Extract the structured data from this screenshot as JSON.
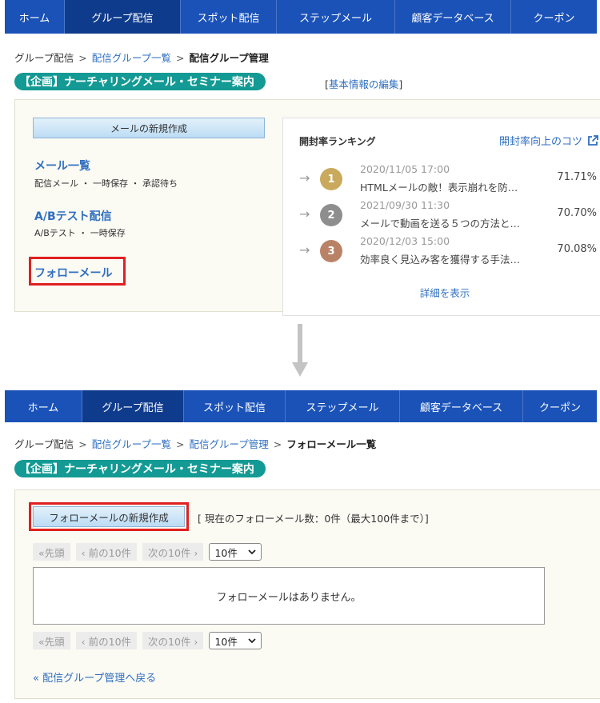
{
  "top": {
    "nav": [
      "ホーム",
      "グループ配信",
      "スポット配信",
      "ステップメール",
      "顧客データベース",
      "クーポン"
    ],
    "breadcrumb": {
      "root": "グループ配信",
      "sep": ">",
      "link1": "配信グループ一覧",
      "current": "配信グループ管理"
    },
    "title": "【企画】ナーチャリングメール・セミナー案内",
    "edit_open": "[",
    "edit_link": "基本情報の編集",
    "edit_close": "]",
    "new_mail_button": "メールの新規作成",
    "menu": [
      {
        "title": "メール一覧",
        "sub": "配信メール ・ 一時保存 ・ 承認待ち"
      },
      {
        "title": "A/Bテスト配信",
        "sub": "A/Bテスト ・ 一時保存"
      },
      {
        "title": "フォローメール",
        "sub": ""
      }
    ],
    "ranking": {
      "title": "開封率ランキング",
      "tip": "開封率向上のコツ",
      "rows": [
        {
          "rank": "1",
          "date": "2020/11/05 17:00",
          "subject": "HTMLメールの敵！表示崩れを防…",
          "rate": "71.71%",
          "color": "#c9a95c"
        },
        {
          "rank": "2",
          "date": "2021/09/30 11:30",
          "subject": "メールで動画を送る５つの方法と…",
          "rate": "70.70%",
          "color": "#8e8e8e"
        },
        {
          "rank": "3",
          "date": "2020/12/03 15:00",
          "subject": "効率良く見込み客を獲得する手法…",
          "rate": "70.08%",
          "color": "#b98266"
        }
      ],
      "more": "詳細を表示"
    }
  },
  "bottom": {
    "nav": [
      "ホーム",
      "グループ配信",
      "スポット配信",
      "ステップメール",
      "顧客データベース",
      "クーポン"
    ],
    "breadcrumb": {
      "root": "グループ配信",
      "sep": ">",
      "link1": "配信グループ一覧",
      "link2": "配信グループ管理",
      "current": "フォローメール一覧"
    },
    "title": "【企画】ナーチャリングメール・セミナー案内",
    "new_follow_button": "フォローメールの新規作成",
    "count_text": "[ 現在のフォローメール数：0件（最大100件まで）]",
    "pager": {
      "first": "«先頭",
      "prev": "‹ 前の10件",
      "next": "次の10件 ›",
      "per_page": "10件"
    },
    "empty_message": "フォローメールはありません。",
    "back_link": "« 配信グループ管理へ戻る"
  },
  "colors": {
    "nav": "#1a52b8",
    "nav_active": "#0f3b8c",
    "teal": "#149a94",
    "link": "#2f6fc1",
    "highlight": "#e02020"
  }
}
